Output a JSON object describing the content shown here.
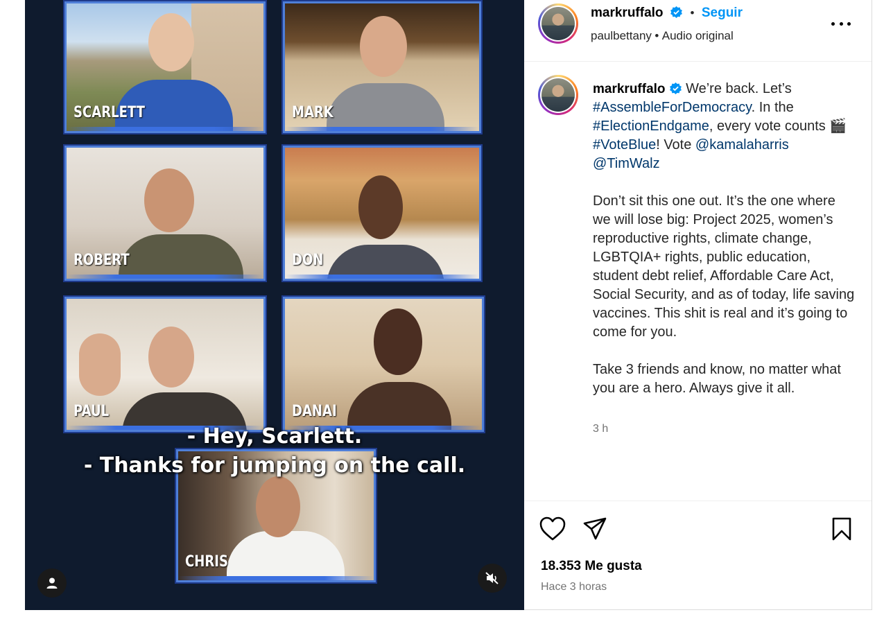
{
  "post": {
    "username": "markruffalo",
    "follow_label": "Seguir",
    "separator": "•",
    "audio_credit_user": "paulbettany",
    "audio_credit_sep": "•",
    "audio_credit_label": "Audio original",
    "more_options_icon": "more-horizontal-icon"
  },
  "caption": {
    "username": "markruffalo",
    "line1_prefix": "We’re back. Let’s",
    "hashtag1": "#AssembleForDemocracy",
    "line2_mid": ". In the",
    "hashtag2": "#ElectionEndgame",
    "line3_mid": ", every vote counts",
    "emoji": "🎬",
    "hashtag3": "#VoteBlue",
    "line4_mid": "! Vote",
    "mention1": "@kamalaharris",
    "mention2": "@TimWalz",
    "paragraph2": "Don’t sit this one out. It’s the one where we will lose big: Project 2025, women’s reproductive rights, climate change, LGBTQIA+ rights, public education, student debt relief, Affordable Care Act, Social Security, and as of today, life saving vaccines. This shit is real and it’s going to come for you.",
    "paragraph3": "Take 3 friends and know, no matter what you are a hero. Always give it all.",
    "time": "3 h"
  },
  "stats": {
    "likes": "18.353 Me gusta",
    "posted": "Hace 3 horas"
  },
  "video": {
    "tiles": [
      {
        "name": "SCARLETT"
      },
      {
        "name": "MARK"
      },
      {
        "name": "ROBERT"
      },
      {
        "name": "DON"
      },
      {
        "name": "PAUL"
      },
      {
        "name": "DANAI"
      },
      {
        "name": "CHRIS"
      }
    ],
    "subtitle_line1": "- Hey, Scarlett.",
    "subtitle_line2": "- Thanks for jumping on the call.",
    "user_icon": "user-icon",
    "mute_icon": "muted-speaker-icon"
  },
  "colors": {
    "accent": "#0095f6",
    "link": "#00376b",
    "verified": "#0095f6",
    "tile_border": "#4f7fd8",
    "video_bg": "#0f1b2e"
  }
}
